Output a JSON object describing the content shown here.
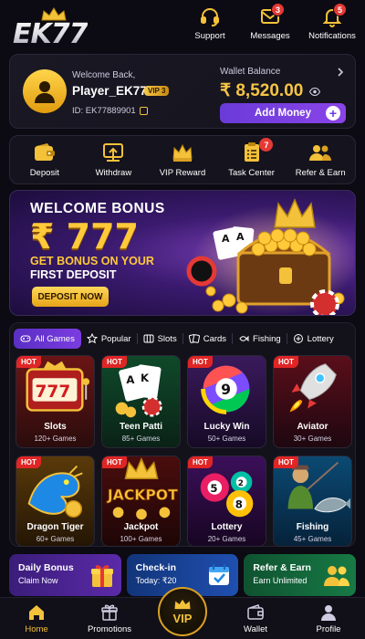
{
  "header": {
    "logo_text": "EK77",
    "actions": [
      {
        "label": "Support",
        "icon": "headset-icon"
      },
      {
        "label": "Messages",
        "icon": "envelope-icon",
        "badge": "3"
      },
      {
        "label": "Notifications",
        "icon": "bell-icon",
        "badge": "5"
      }
    ]
  },
  "account": {
    "welcome": "Welcome Back,",
    "username": "Player_EK77",
    "vip_level": "VIP 3",
    "id_text": "ID: EK77889901",
    "wallet_label": "Wallet Balance",
    "wallet_amount": "₹ 8,520.00",
    "add_money_label": "Add Money"
  },
  "quick_actions": [
    {
      "label": "Deposit",
      "icon": "wallet-icon"
    },
    {
      "label": "Withdraw",
      "icon": "withdraw-icon"
    },
    {
      "label": "VIP Reward",
      "icon": "crown-icon"
    },
    {
      "label": "Task Center",
      "icon": "clipboard-icon",
      "badge": "7"
    },
    {
      "label": "Refer & Earn",
      "icon": "people-icon"
    }
  ],
  "banner": {
    "title": "WELCOME BONUS",
    "amount": "₹ 777",
    "line1": "GET BONUS ON YOUR",
    "line2": "FIRST DEPOSIT",
    "button": "DEPOSIT NOW"
  },
  "game_tabs": [
    {
      "label": "All Games",
      "icon": "gamepad-icon",
      "active": true
    },
    {
      "label": "Popular",
      "icon": "star-icon"
    },
    {
      "label": "Slots",
      "icon": "slot-icon"
    },
    {
      "label": "Cards",
      "icon": "cards-icon"
    },
    {
      "label": "Fishing",
      "icon": "fish-icon"
    },
    {
      "label": "Lottery",
      "icon": "lottery-icon"
    }
  ],
  "games": [
    {
      "name": "Slots",
      "count": "120+ Games",
      "hot": "HOT"
    },
    {
      "name": "Teen Patti",
      "count": "85+ Games",
      "hot": "HOT"
    },
    {
      "name": "Lucky Win",
      "count": "50+ Games",
      "hot": "HOT"
    },
    {
      "name": "Aviator",
      "count": "30+ Games",
      "hot": "HOT"
    },
    {
      "name": "Dragon Tiger",
      "count": "60+ Games",
      "hot": "HOT"
    },
    {
      "name": "Jackpot",
      "count": "100+ Games",
      "hot": "HOT",
      "art_text": "JACKPOT"
    },
    {
      "name": "Lottery",
      "count": "20+ Games",
      "hot": "HOT"
    },
    {
      "name": "Fishing",
      "count": "45+ Games",
      "hot": "HOT"
    }
  ],
  "promos": [
    {
      "title": "Daily Bonus",
      "subtitle": "Claim Now",
      "icon": "gift-icon"
    },
    {
      "title": "Check-in",
      "subtitle": "Today: ₹20",
      "icon": "calendar-check-icon"
    },
    {
      "title": "Refer & Earn",
      "subtitle": "Earn Unlimited",
      "icon": "people-icon"
    }
  ],
  "bottom_nav": [
    {
      "label": "Home",
      "icon": "home-icon",
      "active": true
    },
    {
      "label": "Promotions",
      "icon": "gift-icon"
    },
    {
      "label": "VIP",
      "icon": "crown-icon"
    },
    {
      "label": "Wallet",
      "icon": "wallet-icon"
    },
    {
      "label": "Profile",
      "icon": "person-icon"
    }
  ],
  "colors": {
    "accent_gold": "#f3c13a",
    "accent_purple": "#6a3bd8",
    "badge_red": "#e53935",
    "background": "#0c0a12"
  }
}
